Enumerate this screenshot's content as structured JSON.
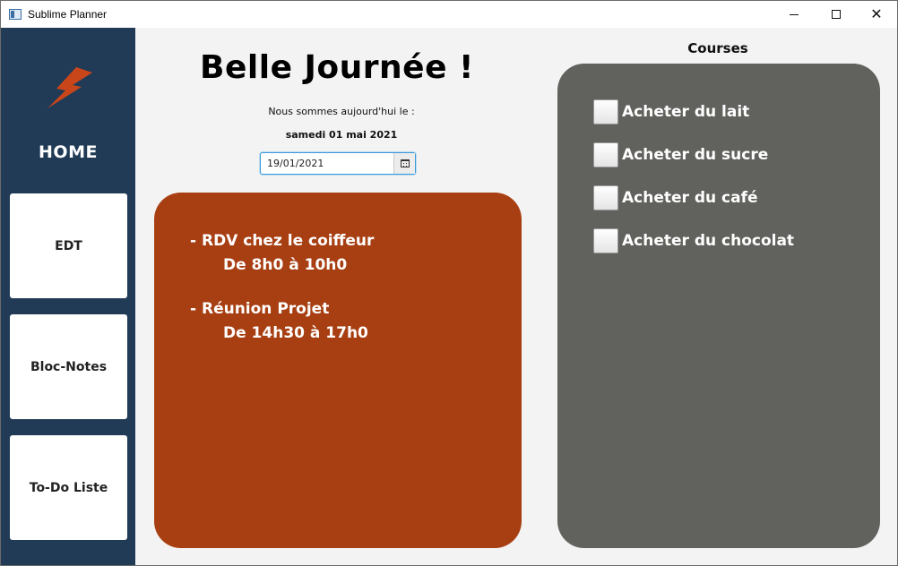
{
  "window": {
    "title": "Sublime Planner",
    "minimize_icon": "minimize-icon",
    "maximize_icon": "maximize-icon",
    "close_icon": "close-icon",
    "close_glyph": "✕"
  },
  "sidebar": {
    "logo_icon": "lightning-bolt-icon",
    "home_label": "HOME",
    "buttons": [
      {
        "label": "EDT"
      },
      {
        "label": "Bloc-Notes"
      },
      {
        "label": "To-Do Liste"
      }
    ]
  },
  "main": {
    "greeting": "Belle Journée !",
    "today_label": "Nous sommes aujourd'hui le :",
    "today_date": "samedi 01 mai 2021",
    "datepicker": {
      "value": "19/01/2021",
      "calendar_icon": "calendar-icon"
    },
    "events": [
      {
        "title": "- RDV chez le coiffeur",
        "time": "De 8h0 à 10h0"
      },
      {
        "title": "- Réunion Projet",
        "time": "De 14h30 à 17h0"
      }
    ]
  },
  "courses": {
    "title": "Courses",
    "items": [
      {
        "label": "Acheter du lait",
        "checked": false
      },
      {
        "label": "Acheter du sucre",
        "checked": false
      },
      {
        "label": "Acheter du café",
        "checked": false
      },
      {
        "label": "Acheter du chocolat",
        "checked": false
      }
    ]
  },
  "colors": {
    "sidebar": "#213b57",
    "events_panel": "#a83f12",
    "courses_panel": "#61615d",
    "logo": "#c8461a"
  }
}
